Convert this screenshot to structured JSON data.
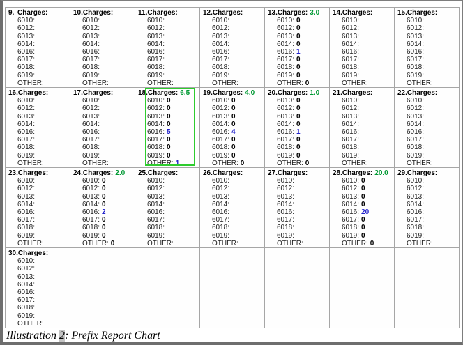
{
  "table": {
    "charges_label": "Charges:",
    "codes": [
      "6010:",
      "6012:",
      "6013:",
      "6014:",
      "6016:",
      "6017:",
      "6018:",
      "6019:",
      "OTHER:"
    ],
    "cells": [
      {
        "num": "9.",
        "total": "",
        "values": [
          "",
          "",
          "",
          "",
          "",
          "",
          "",
          "",
          ""
        ],
        "highlighted": false
      },
      {
        "num": "10.",
        "total": "",
        "values": [
          "",
          "",
          "",
          "",
          "",
          "",
          "",
          "",
          ""
        ],
        "highlighted": false
      },
      {
        "num": "11.",
        "total": "",
        "values": [
          "",
          "",
          "",
          "",
          "",
          "",
          "",
          "",
          ""
        ],
        "highlighted": false
      },
      {
        "num": "12.",
        "total": "",
        "values": [
          "",
          "",
          "",
          "",
          "",
          "",
          "",
          "",
          ""
        ],
        "highlighted": false
      },
      {
        "num": "13.",
        "total": "3.0",
        "values": [
          "0",
          "0",
          "0",
          "0",
          "1",
          "0",
          "0",
          "0",
          "0"
        ],
        "highlighted": false
      },
      {
        "num": "14.",
        "total": "",
        "values": [
          "",
          "",
          "",
          "",
          "",
          "",
          "",
          "",
          ""
        ],
        "highlighted": false
      },
      {
        "num": "15.",
        "total": "",
        "values": [
          "",
          "",
          "",
          "",
          "",
          "",
          "",
          "",
          ""
        ],
        "highlighted": false
      },
      {
        "num": "16.",
        "total": "",
        "values": [
          "",
          "",
          "",
          "",
          "",
          "",
          "",
          "",
          ""
        ],
        "highlighted": false
      },
      {
        "num": "17.",
        "total": "",
        "values": [
          "",
          "",
          "",
          "",
          "",
          "",
          "",
          "",
          ""
        ],
        "highlighted": false
      },
      {
        "num": "18.",
        "total": "6.5",
        "values": [
          "0",
          "0",
          "0",
          "0",
          "5",
          "0",
          "0",
          "0",
          "1"
        ],
        "highlighted": true
      },
      {
        "num": "19.",
        "total": "4.0",
        "values": [
          "0",
          "0",
          "0",
          "0",
          "4",
          "0",
          "0",
          "0",
          "0"
        ],
        "highlighted": false
      },
      {
        "num": "20.",
        "total": "1.0",
        "values": [
          "0",
          "0",
          "0",
          "0",
          "1",
          "0",
          "0",
          "0",
          "0"
        ],
        "highlighted": false
      },
      {
        "num": "21.",
        "total": "",
        "values": [
          "",
          "",
          "",
          "",
          "",
          "",
          "",
          "",
          ""
        ],
        "highlighted": false
      },
      {
        "num": "22.",
        "total": "",
        "values": [
          "",
          "",
          "",
          "",
          "",
          "",
          "",
          "",
          ""
        ],
        "highlighted": false
      },
      {
        "num": "23.",
        "total": "",
        "values": [
          "",
          "",
          "",
          "",
          "",
          "",
          "",
          "",
          ""
        ],
        "highlighted": false
      },
      {
        "num": "24.",
        "total": "2.0",
        "values": [
          "0",
          "0",
          "0",
          "0",
          "2",
          "0",
          "0",
          "0",
          "0"
        ],
        "highlighted": false
      },
      {
        "num": "25.",
        "total": "",
        "values": [
          "",
          "",
          "",
          "",
          "",
          "",
          "",
          "",
          ""
        ],
        "highlighted": false
      },
      {
        "num": "26.",
        "total": "",
        "values": [
          "",
          "",
          "",
          "",
          "",
          "",
          "",
          "",
          ""
        ],
        "highlighted": false
      },
      {
        "num": "27.",
        "total": "",
        "values": [
          "",
          "",
          "",
          "",
          "",
          "",
          "",
          "",
          ""
        ],
        "highlighted": false
      },
      {
        "num": "28.",
        "total": "20.0",
        "values": [
          "0",
          "0",
          "0",
          "0",
          "20",
          "0",
          "0",
          "0",
          "0"
        ],
        "highlighted": false
      },
      {
        "num": "29.",
        "total": "",
        "values": [
          "",
          "",
          "",
          "",
          "",
          "",
          "",
          "",
          ""
        ],
        "highlighted": false
      },
      {
        "num": "30.",
        "total": "",
        "values": [
          "",
          "",
          "",
          "",
          "",
          "",
          "",
          "",
          ""
        ],
        "highlighted": false
      }
    ],
    "empty_filler_cells": 6
  },
  "colors": {
    "total_green": "#009933",
    "value_blue": "#2222cc",
    "highlight_border": "#2ecc2e",
    "grid_border": "#a6a6a6"
  },
  "caption": {
    "prefix": "Illustration ",
    "number": "2",
    "rest": ": Prefix Report Chart"
  }
}
